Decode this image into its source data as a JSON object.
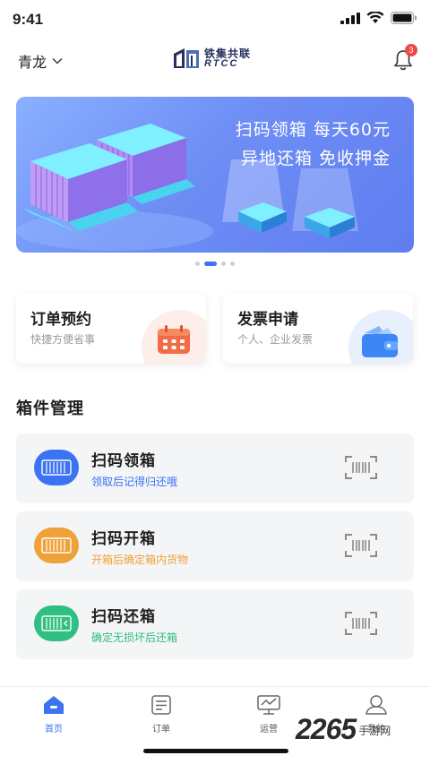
{
  "status_bar": {
    "time": "9:41"
  },
  "header": {
    "location": "青龙",
    "logo_cn": "铁集共联",
    "logo_en": "RTCC",
    "notification_count": "3"
  },
  "banner": {
    "line1": "扫码领箱  每天60元",
    "line2": "异地还箱  免收押金"
  },
  "carousel": {
    "count": 4,
    "active_index": 1
  },
  "quick_actions": [
    {
      "title": "订单预约",
      "subtitle": "快捷方便省事"
    },
    {
      "title": "发票申请",
      "subtitle": "个人、企业发票"
    }
  ],
  "section": {
    "title": "箱件管理"
  },
  "box_actions": [
    {
      "title": "扫码领箱",
      "desc": "领取后记得归还哦",
      "color": "#3b73f2"
    },
    {
      "title": "扫码开箱",
      "desc": "开箱后确定箱内货物",
      "color": "#f0a23a"
    },
    {
      "title": "扫码还箱",
      "desc": "确定无损坏后还箱",
      "color": "#2fbf82"
    }
  ],
  "tabs": [
    {
      "label": "首页",
      "icon": "home-icon",
      "active": true
    },
    {
      "label": "订单",
      "icon": "order-icon",
      "active": false
    },
    {
      "label": "运营",
      "icon": "operation-icon",
      "active": false
    },
    {
      "label": "我的",
      "icon": "profile-icon",
      "active": false
    }
  ],
  "watermark": {
    "number": "2265",
    "text": "手游网"
  },
  "colors": {
    "accent": "#3b73f2",
    "badge": "#f04747",
    "orange": "#f0a23a",
    "green": "#2fbf82"
  }
}
